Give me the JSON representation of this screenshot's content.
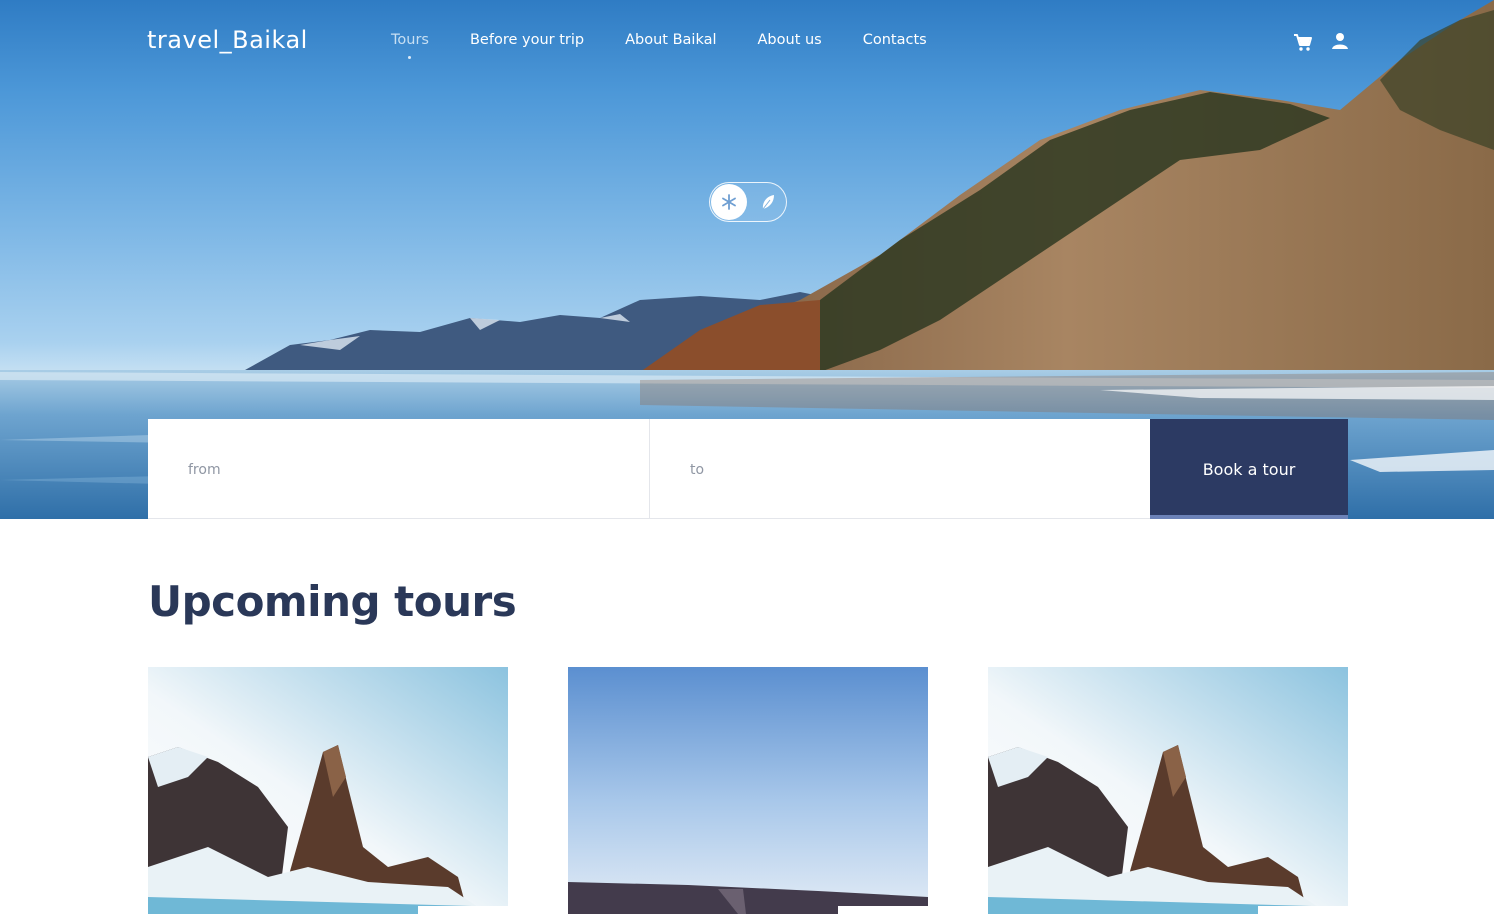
{
  "brand": {
    "logo_text": "travel_Baikal"
  },
  "nav": {
    "items": [
      {
        "label": "Tours",
        "active": true
      },
      {
        "label": "Before your trip",
        "active": false
      },
      {
        "label": "About Baikal",
        "active": false
      },
      {
        "label": "About us",
        "active": false
      },
      {
        "label": "Contacts",
        "active": false
      }
    ]
  },
  "header_icons": {
    "cart": "cart-icon",
    "user": "user-icon"
  },
  "season_toggle": {
    "selected": "winter",
    "options": [
      "winter-snowflake-icon",
      "summer-leaf-icon"
    ]
  },
  "booking": {
    "from_placeholder": "from",
    "to_placeholder": "to",
    "button_label": "Book a tour"
  },
  "upcoming": {
    "title": "Upcoming tours",
    "cards": [
      {
        "image": "rock-in-ice"
      },
      {
        "image": "sky-horizon"
      },
      {
        "image": "rock-in-ice"
      }
    ]
  },
  "colors": {
    "accent_navy": "#2c3a63",
    "title_navy": "#2a3858",
    "button_underline": "#6c82b8"
  }
}
